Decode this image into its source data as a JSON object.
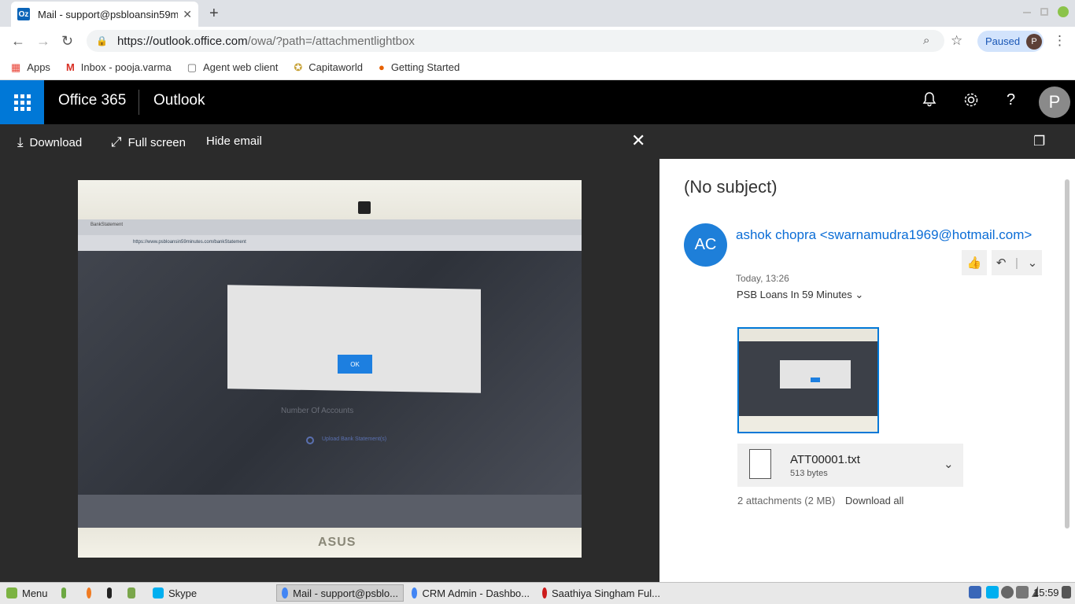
{
  "browser": {
    "tab_title": "Mail - support@psbloansin59m",
    "tab_favicon": "Oz",
    "url_host": "https://outlook.office.com",
    "url_path": "/owa/?path=/attachmentlightbox",
    "profile_label": "Paused",
    "profile_initial": "P",
    "bookmarks": [
      {
        "label": "Apps",
        "icon": "apps-grid-icon"
      },
      {
        "label": "Inbox - pooja.varma",
        "icon": "gmail-icon"
      },
      {
        "label": "Agent web client",
        "icon": "page-icon"
      },
      {
        "label": "Capitaworld",
        "icon": "capitaworld-icon"
      },
      {
        "label": "Getting Started",
        "icon": "firefox-icon"
      }
    ]
  },
  "o365": {
    "brand": "Office 365",
    "app": "Outlook",
    "user_initial": "P",
    "colors": {
      "waffle": "#0078d7",
      "header": "#000000"
    }
  },
  "lightbox": {
    "download": "Download",
    "fullscreen": "Full screen",
    "hide_email": "Hide email"
  },
  "email": {
    "subject": "(No subject)",
    "sender_initials": "AC",
    "sender": "ashok chopra <swarnamudra1969@hotmail.com>",
    "time": "Today, 13:26",
    "to": "PSB Loans In 59 Minutes",
    "attachment": {
      "name": "ATT00001.txt",
      "size": "513 bytes"
    },
    "attachments_count": "2 attachments (2 MB)",
    "download_all": "Download all"
  },
  "photo": {
    "dialog_button": "OK",
    "laptop_brand": "ASUS",
    "screen_tab": "BankStatement",
    "screen_url": "https://www.psbloansin59minutes.com/bankStatement",
    "screen_heading": "Number Of Accounts",
    "screen_option": "Upload Bank Statement(s)"
  },
  "taskbar": {
    "menu": "Menu",
    "skype": "Skype",
    "windows": [
      "Mail - support@psblo...",
      "CRM Admin - Dashbo...",
      "Saathiya Singham Ful..."
    ],
    "clock": "15:59"
  }
}
